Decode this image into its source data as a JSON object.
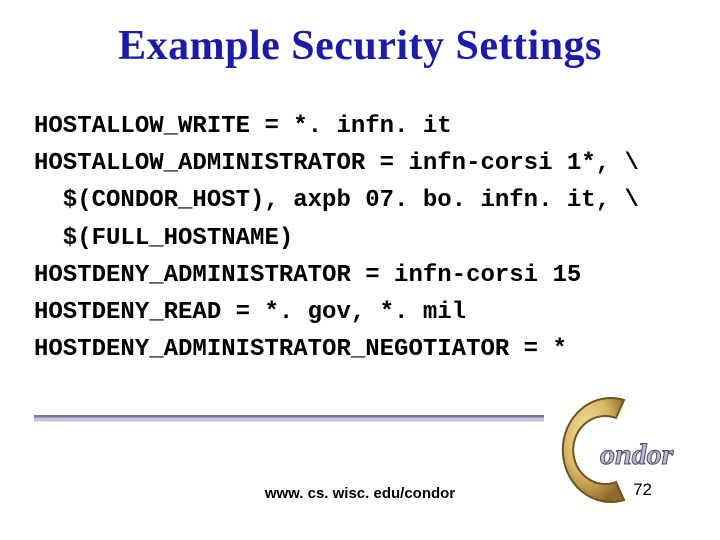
{
  "title": "Example Security Settings",
  "code": {
    "l1": "HOSTALLOW_WRITE = *. infn. it",
    "l2": "HOSTALLOW_ADMINISTRATOR = infn-corsi 1*, \\",
    "l3": "  $(CONDOR_HOST), axpb 07. bo. infn. it, \\",
    "l4": "  $(FULL_HOSTNAME)",
    "l5": "HOSTDENY_ADMINISTRATOR = infn-corsi 15",
    "l6": "HOSTDENY_READ = *. gov, *. mil",
    "l7": "HOSTDENY_ADMINISTRATOR_NEGOTIATOR = *"
  },
  "footer_url": "www. cs. wisc. edu/condor",
  "page_number": "72",
  "logo_text": "ondor",
  "colors": {
    "title": "#1b1ab0",
    "logo_c_outer": "#b0873c",
    "logo_c_inner": "#e6c97a",
    "logo_text_fill": "#bfb9d2",
    "logo_text_stroke": "#514a6e"
  }
}
